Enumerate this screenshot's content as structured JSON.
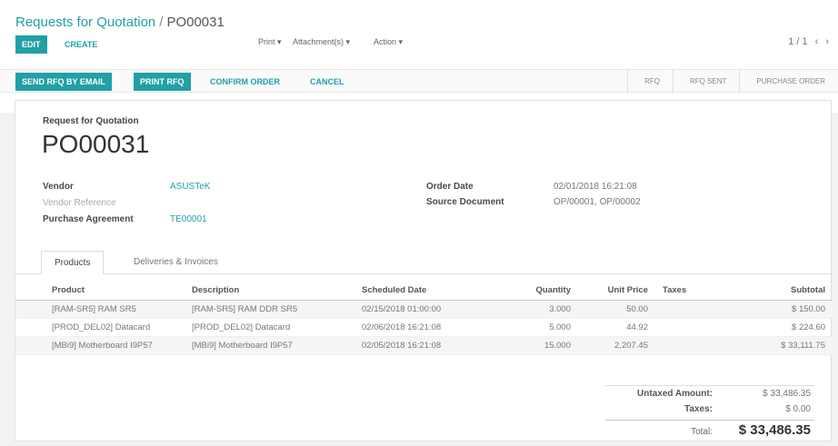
{
  "breadcrumb": {
    "parent": "Requests for Quotation",
    "separator": "/",
    "current": "PO00031"
  },
  "toolbar": {
    "edit": "EDIT",
    "create": "CREATE",
    "print": "Print ▾",
    "attachments": "Attachment(s) ▾",
    "action": "Action ▾"
  },
  "pager": {
    "value": "1 / 1",
    "prev": "‹",
    "next": "›"
  },
  "statusbar": {
    "send_rfq": "SEND RFQ BY EMAIL",
    "print_rfq": "PRINT RFQ",
    "confirm": "CONFIRM ORDER",
    "cancel": "CANCEL",
    "stages": [
      "RFQ",
      "RFQ SENT",
      "PURCHASE ORDER"
    ]
  },
  "document": {
    "type": "Request for Quotation",
    "name": "PO00031",
    "vendor_label": "Vendor",
    "vendor": "ASUSTeK",
    "vendor_ref_label": "Vendor Reference",
    "agreement_label": "Purchase Agreement",
    "agreement": "TE00001",
    "order_date_label": "Order Date",
    "order_date": "02/01/2018 16:21:08",
    "source_label": "Source Document",
    "source": "OP/00001, OP/00002"
  },
  "tabs": [
    "Products",
    "Deliveries & Invoices"
  ],
  "table": {
    "headers": [
      "Product",
      "Description",
      "Scheduled Date",
      "Quantity",
      "Unit Price",
      "Taxes",
      "Subtotal"
    ],
    "rows": [
      [
        "[RAM-SR5] RAM SR5",
        "[RAM-SR5] RAM DDR SR5",
        "02/15/2018 01:00:00",
        "3.000",
        "50.00",
        "",
        "$ 150.00"
      ],
      [
        "[PROD_DEL02] Datacard",
        "[PROD_DEL02] Datacard",
        "02/06/2018 16:21:08",
        "5.000",
        "44.92",
        "",
        "$ 224.60"
      ],
      [
        "[MBi9] Motherboard I9P57",
        "[MBi9] Motherboard I9P57",
        "02/05/2018 16:21:08",
        "15.000",
        "2,207.45",
        "",
        "$ 33,111.75"
      ]
    ]
  },
  "totals": {
    "untaxed_label": "Untaxed Amount:",
    "untaxed": "$ 33,486.35",
    "taxes_label": "Taxes:",
    "taxes": "$ 0.00",
    "total_label": "Total:",
    "total": "$ 33,486.35"
  },
  "colors": {
    "accent": "#21a0a6"
  }
}
